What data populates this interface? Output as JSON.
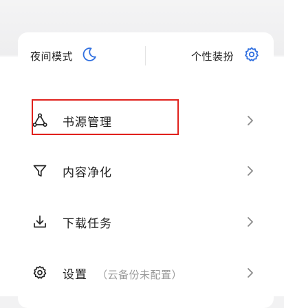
{
  "quick": {
    "night_mode_label": "夜间模式",
    "theme_label": "个性装扮"
  },
  "menu": {
    "items": [
      {
        "label": "书源管理",
        "sub": "",
        "icon": "book-source-icon"
      },
      {
        "label": "内容净化",
        "sub": "",
        "icon": "filter-icon"
      },
      {
        "label": "下载任务",
        "sub": "",
        "icon": "download-icon"
      },
      {
        "label": "设置",
        "sub": "（云备份未配置）",
        "icon": "gear-icon"
      }
    ]
  },
  "colors": {
    "accent_blue": "#2f6fe0",
    "highlight_red": "#e0201c"
  }
}
